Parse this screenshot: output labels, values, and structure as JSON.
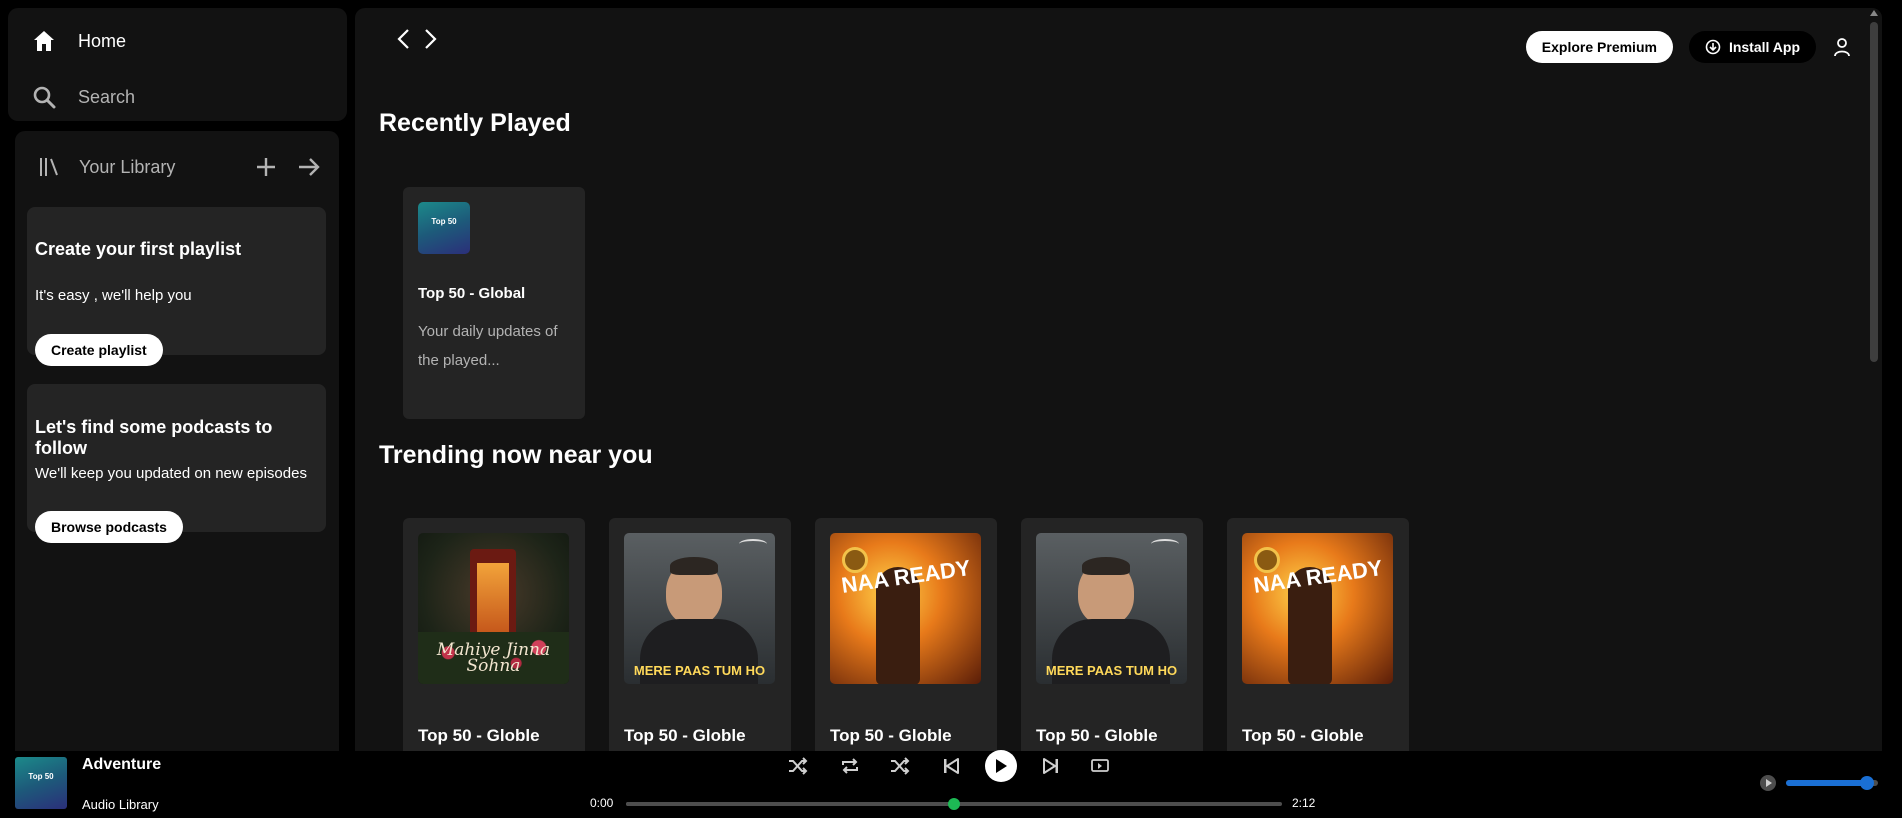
{
  "sidebar": {
    "home_label": "Home",
    "search_label": "Search",
    "library_label": "Your Library",
    "playlist_card": {
      "title": "Create your first playlist",
      "subtitle": "It's easy , we'll help you",
      "button": "Create playlist"
    },
    "podcast_card": {
      "title": "Let's find some podcasts to follow",
      "subtitle": "We'll keep you updated on new episodes",
      "button": "Browse podcasts"
    }
  },
  "header": {
    "premium_button": "Explore Premium",
    "install_button": "Install App"
  },
  "recently_played": {
    "title": "Recently Played",
    "items": [
      {
        "title": "Top 50 - Global",
        "description": "Your daily updates of the played...",
        "art": "top50",
        "art_text": "Top 50"
      }
    ]
  },
  "trending": {
    "title": "Trending now near you",
    "items": [
      {
        "title": "Top 50 - Globle",
        "art": "booth",
        "art_text": "Mahiye Jinna Sohna"
      },
      {
        "title": "Top 50 - Globle",
        "art": "man",
        "art_text": "MERE PAAS TUM HO"
      },
      {
        "title": "Top 50 - Globle",
        "art": "fire",
        "art_text": "NAA READY"
      },
      {
        "title": "Top 50 - Globle",
        "art": "man",
        "art_text": "MERE PAAS TUM HO"
      },
      {
        "title": "Top 50 - Globle",
        "art": "fire",
        "art_text": "NAA READY"
      }
    ]
  },
  "player": {
    "track_title": "Adventure",
    "track_artist": "Audio Library",
    "thumb_text": "Top 50",
    "current_time": "0:00",
    "total_time": "2:12",
    "progress_fraction": 0.5,
    "volume_fraction": 0.88
  },
  "colors": {
    "accent_green": "#1db954",
    "volume_blue": "#1a6fd4",
    "panel": "#121212",
    "card": "#242424"
  }
}
